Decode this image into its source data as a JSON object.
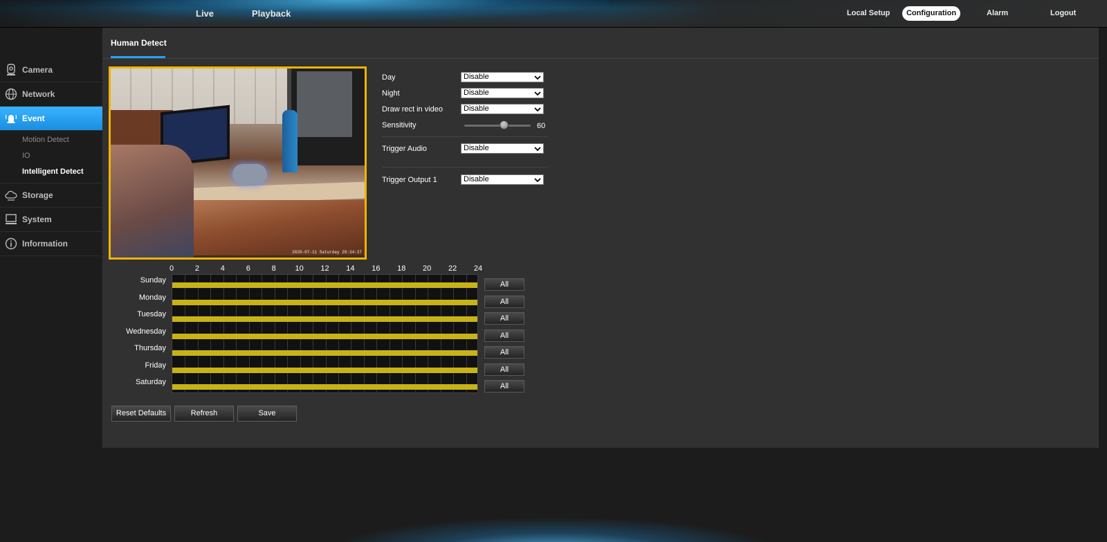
{
  "header": {
    "nav_main": [
      "Live",
      "Playback"
    ],
    "nav_right": [
      "Local Setup",
      "Configuration",
      "Alarm",
      "Logout"
    ],
    "active": "Configuration"
  },
  "sidebar": {
    "items": [
      {
        "label": "Camera",
        "icon": "camera-icon"
      },
      {
        "label": "Network",
        "icon": "globe-icon"
      },
      {
        "label": "Event",
        "icon": "alarm-bell-icon",
        "active": true
      },
      {
        "label": "Storage",
        "icon": "cloud-icon"
      },
      {
        "label": "System",
        "icon": "monitor-icon"
      },
      {
        "label": "Information",
        "icon": "info-icon"
      }
    ],
    "event_sub": [
      "Motion Detect",
      "IO",
      "Intelligent Detect"
    ],
    "event_sub_active": "Intelligent Detect"
  },
  "tab": {
    "title": "Human Detect"
  },
  "video": {
    "timestamp": "2020-07-11 Saturday 20:34:37"
  },
  "form": {
    "day_label": "Day",
    "day_value": "Disable",
    "night_label": "Night",
    "night_value": "Disable",
    "draw_label": "Draw rect in video",
    "draw_value": "Disable",
    "sensitivity_label": "Sensitivity",
    "sensitivity_value": "60",
    "trigger_audio_label": "Trigger Audio",
    "trigger_audio_value": "Disable",
    "trigger_output_label": "Trigger Output 1",
    "trigger_output_value": "Disable"
  },
  "schedule": {
    "hours": [
      "0",
      "2",
      "4",
      "6",
      "8",
      "10",
      "12",
      "14",
      "16",
      "18",
      "20",
      "22",
      "24"
    ],
    "days": [
      "Sunday",
      "Monday",
      "Tuesday",
      "Wednesday",
      "Thursday",
      "Friday",
      "Saturday"
    ],
    "all_label": "All",
    "bar_color": "#c7b318"
  },
  "buttons": {
    "reset": "Reset Defaults",
    "refresh": "Refresh",
    "save": "Save"
  },
  "colors": {
    "accent": "#1f93e6",
    "video_border": "#f0b400"
  }
}
